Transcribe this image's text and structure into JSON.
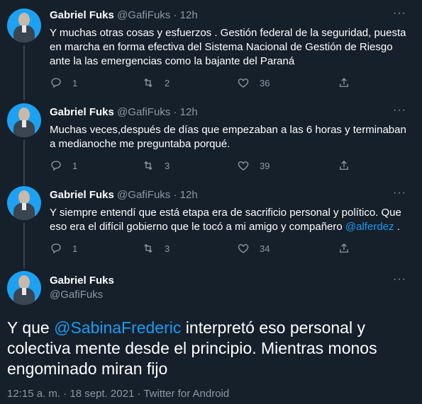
{
  "tweets": [
    {
      "name": "Gabriel Fuks",
      "handle": "@GafiFuks",
      "time": "12h",
      "text": "Y muchas otras cosas y esfuerzos . Gestión federal de la seguridad,  puesta en marcha en forma efectiva del Sistema Nacional de Gestión de Riesgo ante la las emergencias como la bajante del Paraná",
      "replies": "1",
      "retweets": "2",
      "likes": "36"
    },
    {
      "name": "Gabriel Fuks",
      "handle": "@GafiFuks",
      "time": "12h",
      "text": "Muchas veces,después de días que empezaban a las 6 horas y terminaban a medianoche me preguntaba porqué.",
      "replies": "1",
      "retweets": "3",
      "likes": "39"
    },
    {
      "name": "Gabriel Fuks",
      "handle": "@GafiFuks",
      "time": "12h",
      "text_before": "Y siempre entendí que está etapa era de sacrificio personal y político.  Que eso era el difícil gobierno que le tocó a mi amigo y compañero ",
      "mention": "@alferdez",
      "text_after": " .",
      "replies": "1",
      "retweets": "3",
      "likes": "34"
    }
  ],
  "main_tweet": {
    "name": "Gabriel Fuks",
    "handle": "@GafiFuks",
    "text_before": "Y que ",
    "mention": "@SabinaFrederic",
    "text_after": " interpretó eso personal y colectiva mente desde el principio. Mientras monos engominado miran fijo",
    "meta": "12:15 a. m. · 18 sept. 2021 · Twitter for Android"
  },
  "colors": {
    "background": "#15202b",
    "link": "#1d9bf0",
    "secondary_text": "#8b98a5",
    "avatar_bg": "#1da1f2"
  },
  "icons": {
    "more": "more-dots-icon",
    "reply": "reply-icon",
    "retweet": "retweet-icon",
    "like": "heart-icon",
    "share": "share-icon"
  }
}
